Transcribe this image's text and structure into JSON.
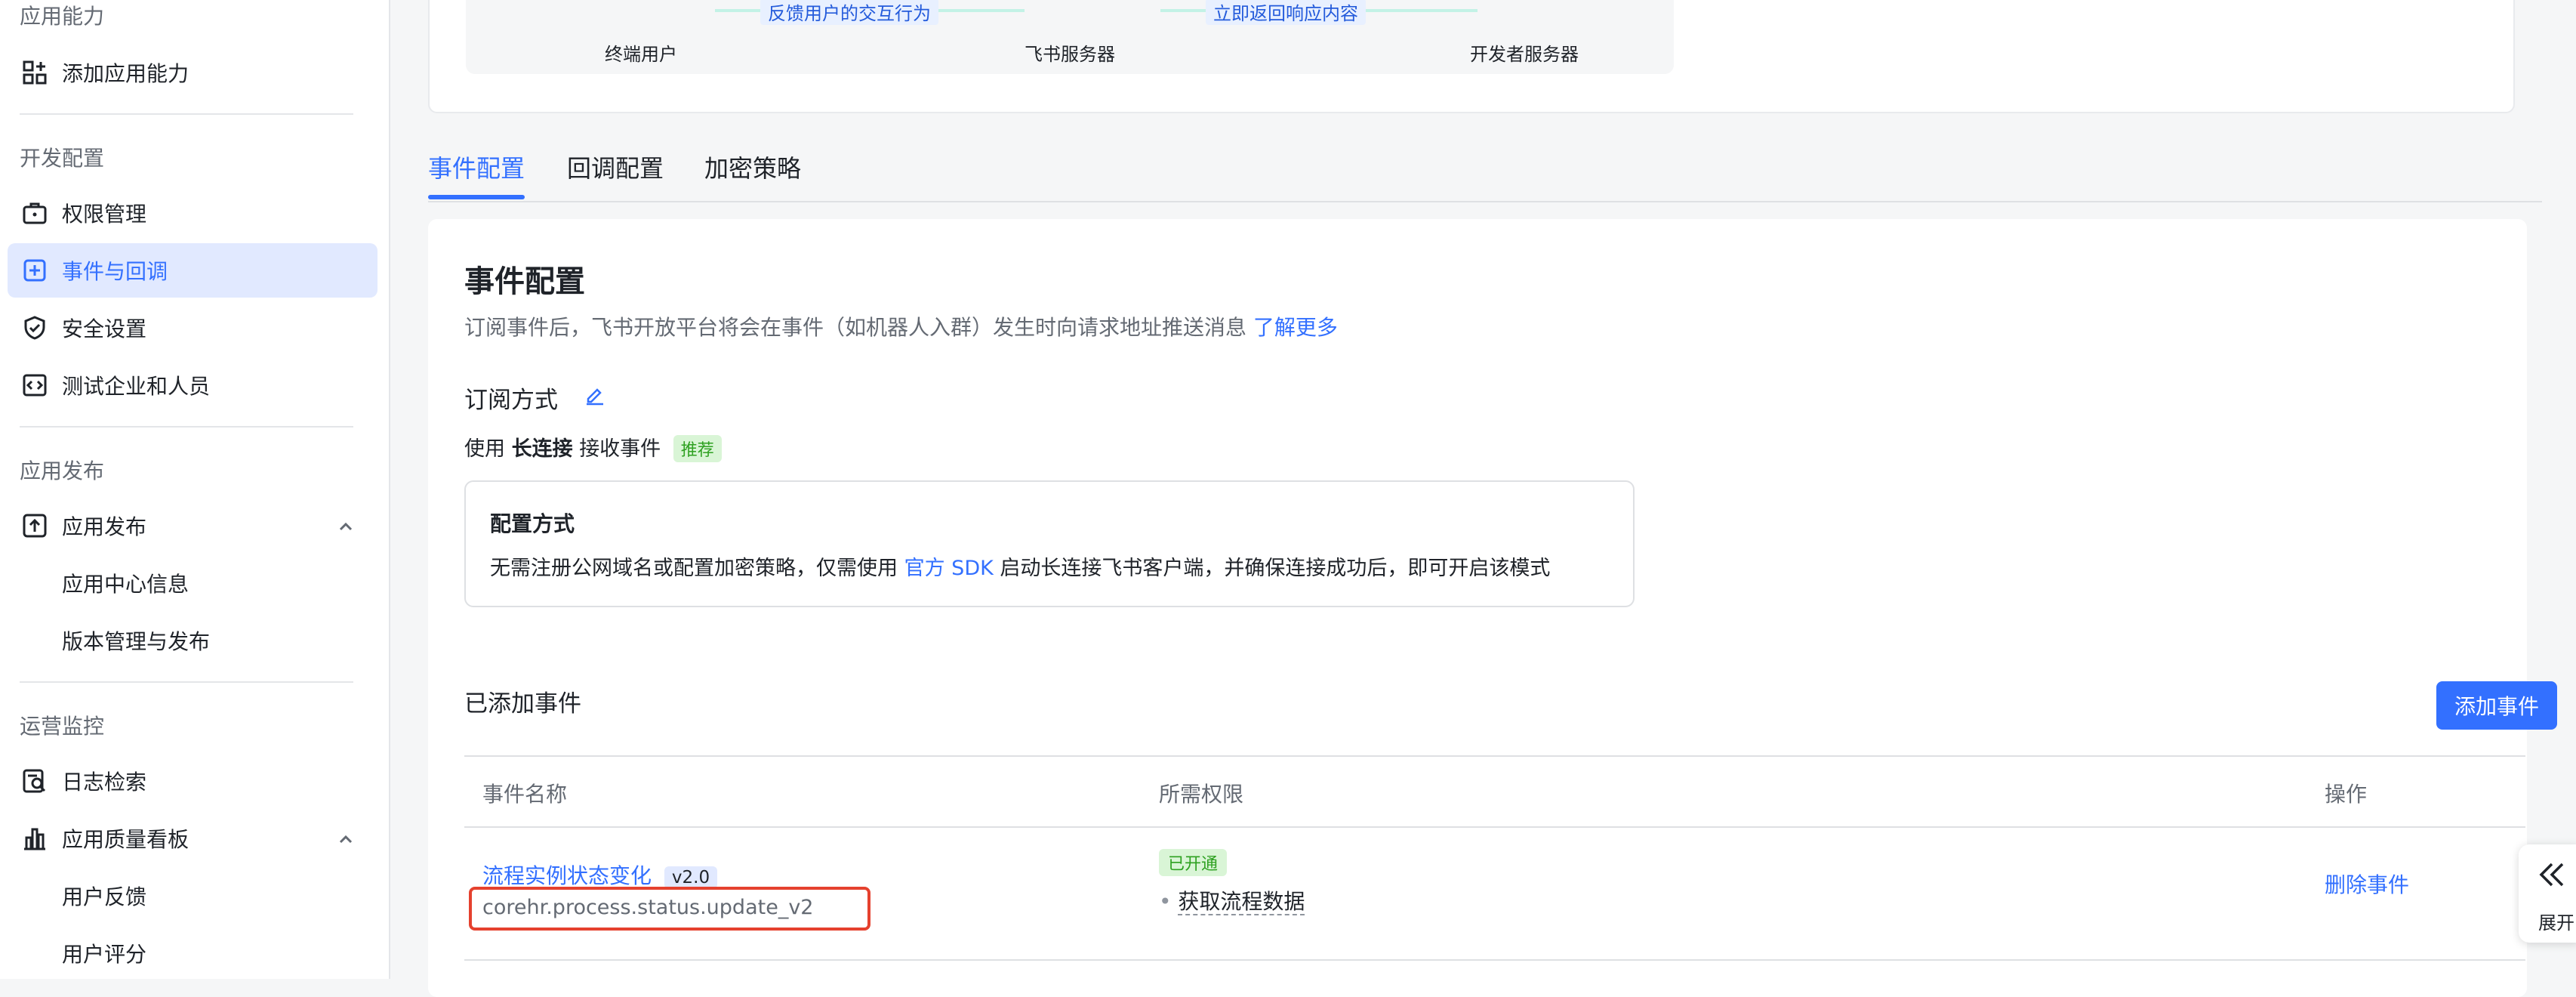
{
  "sidebar": {
    "sections": [
      {
        "title": "应用能力"
      },
      {
        "title": "开发配置"
      },
      {
        "title": "应用发布"
      },
      {
        "title": "运营监控"
      }
    ],
    "items": {
      "add_capability": "添加应用能力",
      "permissions": "权限管理",
      "events": "事件与回调",
      "security": "安全设置",
      "test_org": "测试企业和人员",
      "publish": "应用发布",
      "app_center": "应用中心信息",
      "version": "版本管理与发布",
      "log_search": "日志检索",
      "quality": "应用质量看板",
      "feedback": "用户反馈",
      "rating": "用户评分"
    }
  },
  "flow": {
    "end_user": "终端用户",
    "feedback_action": "反馈用户的交互行为",
    "feishu_server": "飞书服务器",
    "immediate_response": "立即返回响应内容",
    "dev_server": "开发者服务器"
  },
  "tabs": [
    "事件配置",
    "回调配置",
    "加密策略"
  ],
  "event_config": {
    "title": "事件配置",
    "desc": "订阅事件后，飞书开放平台将会在事件（如机器人入群）发生时向请求地址推送消息",
    "learn_more": "了解更多",
    "subscribe_title": "订阅方式",
    "usage_prefix": "使用",
    "usage_bold": "长连接",
    "usage_suffix": "接收事件",
    "recommended": "推荐",
    "config_title": "配置方式",
    "config_text_1": "无需注册公网域名或配置加密策略，仅需使用",
    "config_link": "官方 SDK",
    "config_text_2": "启动长连接飞书客户端，并确保连接成功后，即可开启该模式"
  },
  "added_events": {
    "title": "已添加事件",
    "add_button": "添加事件",
    "columns": [
      "事件名称",
      "所需权限",
      "操作"
    ],
    "rows": [
      {
        "name": "流程实例状态变化",
        "version": "v2.0",
        "key": "corehr.process.status.update_v2",
        "perm_status": "已开通",
        "permission": "获取流程数据",
        "action": "删除事件"
      }
    ]
  },
  "expand_label": "展开",
  "colors": {
    "accent": "#3370ff",
    "highlight": "#e5412e",
    "success": "#2ea121"
  }
}
